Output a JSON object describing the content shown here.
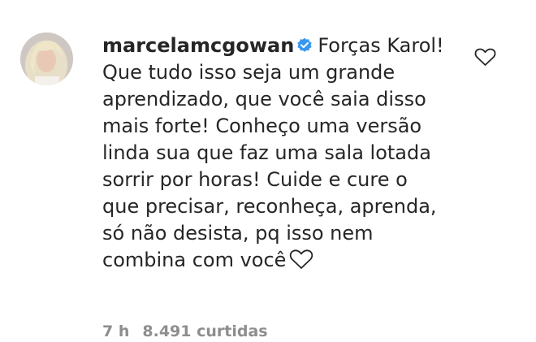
{
  "comment": {
    "username": "marcelamcgowan",
    "verified": true,
    "lines": [
      "Forças Karol!",
      "Que tudo isso seja um grande",
      "aprendizado, que você saia disso",
      "mais forte! Conheço uma versão",
      "linda sua que faz uma sala lotada",
      "sorrir por horas! Cuide e cure o",
      "que precisar, reconheça, aprenda,",
      "só não desista, pq isso nem",
      "combina com você"
    ],
    "emoji_icon": "heart-outline",
    "time": "7 h",
    "likes": "8.491 curtidas"
  },
  "icons": {
    "like": "heart-outline",
    "verified": "verified-badge"
  },
  "colors": {
    "text": "#262626",
    "secondary": "#8e8e8e",
    "verified": "#3897f0"
  }
}
